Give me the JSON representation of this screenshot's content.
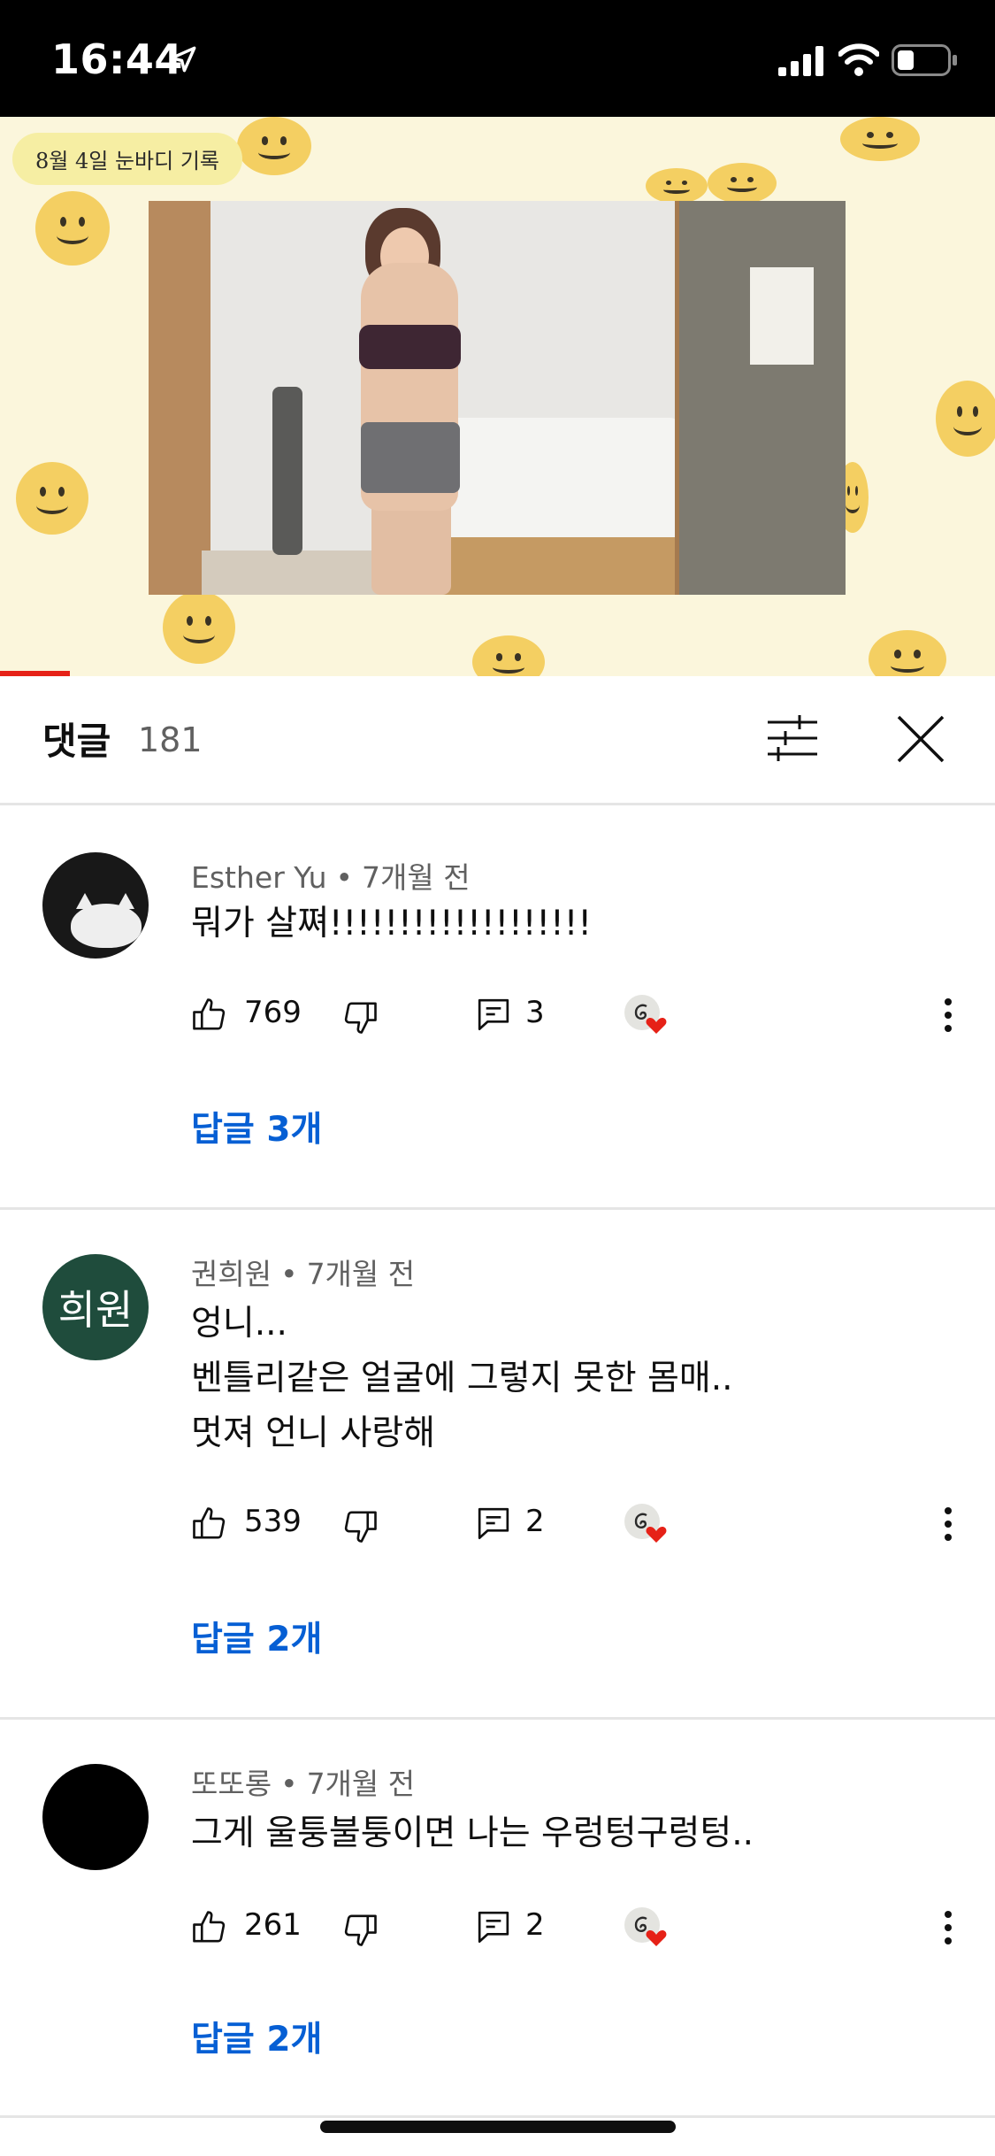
{
  "status_bar": {
    "time": "16:44"
  },
  "video": {
    "overlay_caption": "8월 4일 눈바디 기록",
    "progress": 0.07
  },
  "comments_panel": {
    "title": "댓글",
    "count": "181"
  },
  "comments": [
    {
      "author": "Esther Yu",
      "time_ago": "7개월 전",
      "text_lines": [
        "뭐가 살쪄!!!!!!!!!!!!!!!!!!!"
      ],
      "likes": "769",
      "reply_count": "3",
      "replies_label": "답글 3개"
    },
    {
      "author": "권희원",
      "avatar_text": "희원",
      "time_ago": "7개월 전",
      "text_lines": [
        "엉니...",
        "벤틀리같은 얼굴에 그렇지 못한 몸매..",
        "멋져 언니 사랑해"
      ],
      "likes": "539",
      "reply_count": "2",
      "replies_label": "답글 2개"
    },
    {
      "author": "또또롱",
      "time_ago": "7개월 전",
      "text_lines": [
        "그게 울퉁불퉁이면 나는 우렁텅구렁텅.."
      ],
      "likes": "261",
      "reply_count": "2",
      "replies_label": "답글 2개"
    }
  ],
  "colors": {
    "link": "#065fd4",
    "progress": "#e62117",
    "heart": "#e62117"
  }
}
